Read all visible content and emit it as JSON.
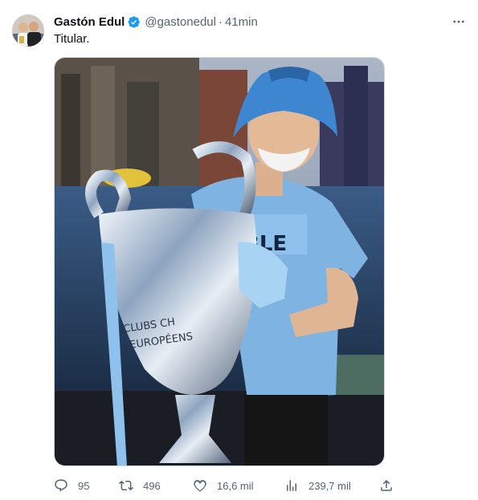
{
  "author": {
    "name": "Gastón Edul",
    "handle": "@gastonedul",
    "separator": "·",
    "time": "41min",
    "verified": true,
    "verified_color": "#1d9bf0"
  },
  "tweet": {
    "text": "Titular."
  },
  "media": {
    "trophy_inscription_line1": "CLUBS CH",
    "trophy_inscription_line2": "EUROPÉENS",
    "shirt_text": "BLE"
  },
  "actions": {
    "replies": "95",
    "retweets": "496",
    "likes": "16,6 mil",
    "views": "239,7 mil"
  },
  "icons": {
    "more": "more-dots-icon",
    "reply": "reply-icon",
    "retweet": "retweet-icon",
    "like": "heart-icon",
    "views": "views-chart-icon",
    "share": "share-icon"
  },
  "colors": {
    "text": "#0f1419",
    "secondary": "#536471",
    "brand": "#1d9bf0"
  }
}
